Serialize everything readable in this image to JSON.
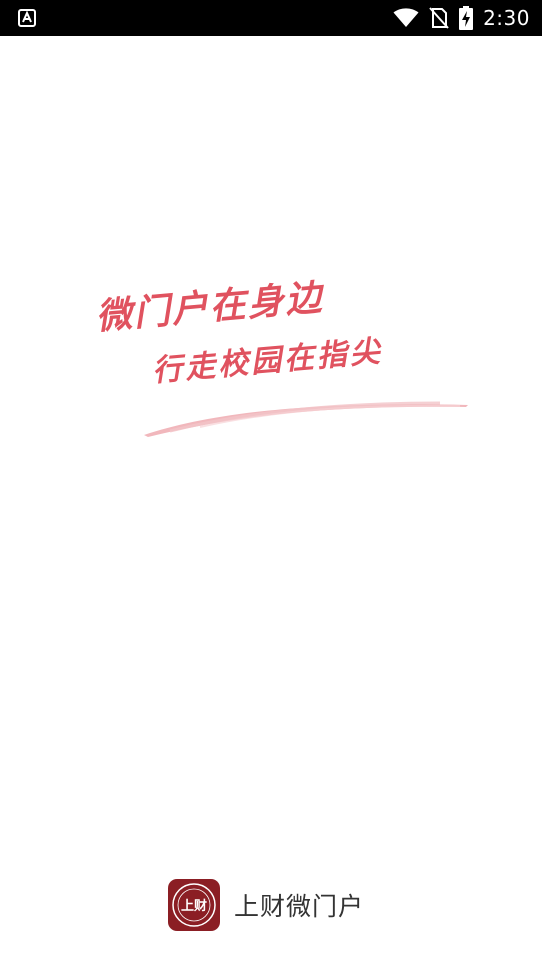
{
  "status_bar": {
    "time": "2:30",
    "icons": [
      "accessibility-a-icon",
      "wifi-icon",
      "no-sim-icon",
      "battery-charging-icon"
    ]
  },
  "splash": {
    "slogan_line_1": "微门户在身边",
    "slogan_line_2": "行走校园在指尖"
  },
  "brand": {
    "logo_text": "上财",
    "name": "上财微门户"
  },
  "colors": {
    "slogan": "#e0525f",
    "logo_bg": "#8b1e24",
    "status_bar_bg": "#000000"
  }
}
